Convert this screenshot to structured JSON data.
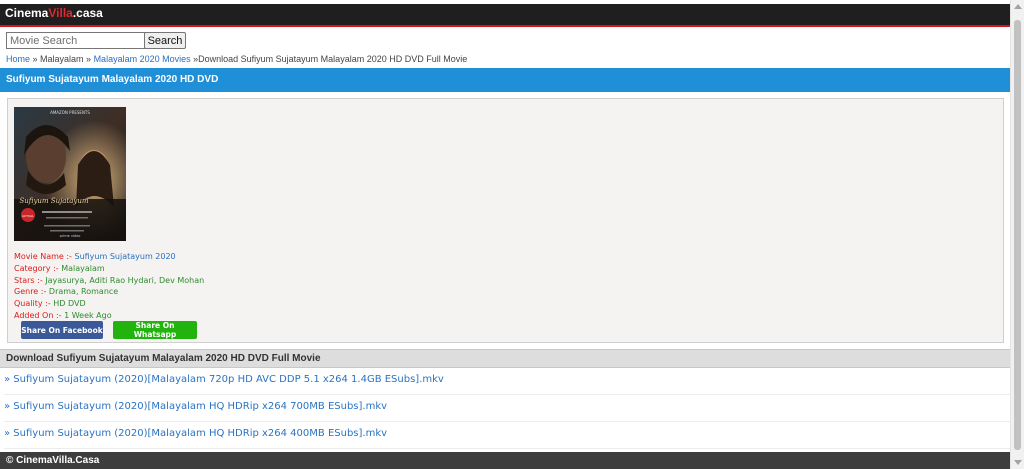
{
  "header": {
    "logo_part1": "Cinema",
    "logo_part2": "Villa",
    "logo_part3": ".casa"
  },
  "search": {
    "placeholder": "Movie Search",
    "button_label": "Search"
  },
  "breadcrumb": {
    "home": "Home",
    "sep1": " » ",
    "category": "Malayalam",
    "sep2": " » ",
    "year": "Malayalam 2020 Movies",
    "sep3": " »",
    "current": "Download Sufiyum Sujatayum Malayalam 2020 HD DVD Full Movie"
  },
  "page_title": "Sufiyum Sujatayum Malayalam 2020 HD DVD",
  "poster": {
    "top_text": "AMAZON PRESENTS",
    "title_text": "Sufiyum Sujatayum",
    "badge_text": "ACTUAL",
    "bottom_text": "prime video"
  },
  "movie_info": [
    {
      "label": "Movie Name :-",
      "value": " Sufiyum Sujatayum 2020",
      "value_color": "blue"
    },
    {
      "label": "Category :-",
      "value": " Malayalam",
      "value_color": "green"
    },
    {
      "label": "Stars :-",
      "value": " Jayasurya, Aditi Rao Hydari, Dev Mohan",
      "value_color": "green"
    },
    {
      "label": "Genre :-",
      "value": " Drama, Romance",
      "value_color": "green"
    },
    {
      "label": "Quality :-",
      "value": " HD DVD",
      "value_color": "green"
    },
    {
      "label": "Added On :-",
      "value": " 1 Week Ago",
      "value_color": "green"
    }
  ],
  "share": {
    "facebook_label": "Share On Facebook",
    "whatsapp_label": "Share On Whatsapp"
  },
  "downloads": {
    "header": "Download Sufiyum Sujatayum Malayalam 2020 HD DVD Full Movie",
    "links": [
      "» Sufiyum Sujatayum (2020)[Malayalam 720p HD AVC DDP 5.1 x264 1.4GB ESubs].mkv",
      "» Sufiyum Sujatayum (2020)[Malayalam HQ HDRip x264 700MB ESubs].mkv",
      "» Sufiyum Sujatayum (2020)[Malayalam HQ HDRip x264 400MB ESubs].mkv"
    ]
  },
  "footer": {
    "text": "© CinemaVilla.Casa"
  },
  "colors": {
    "header_bg": "#1f1f1f",
    "header_border": "#d6121a",
    "title_bar": "#1f8fd8",
    "link": "#2a73c4",
    "label_red": "#e01a1a",
    "value_green": "#2e8b2e",
    "facebook": "#3b5998",
    "whatsapp": "#22b30f",
    "footer_bg": "#3d3d3d"
  }
}
